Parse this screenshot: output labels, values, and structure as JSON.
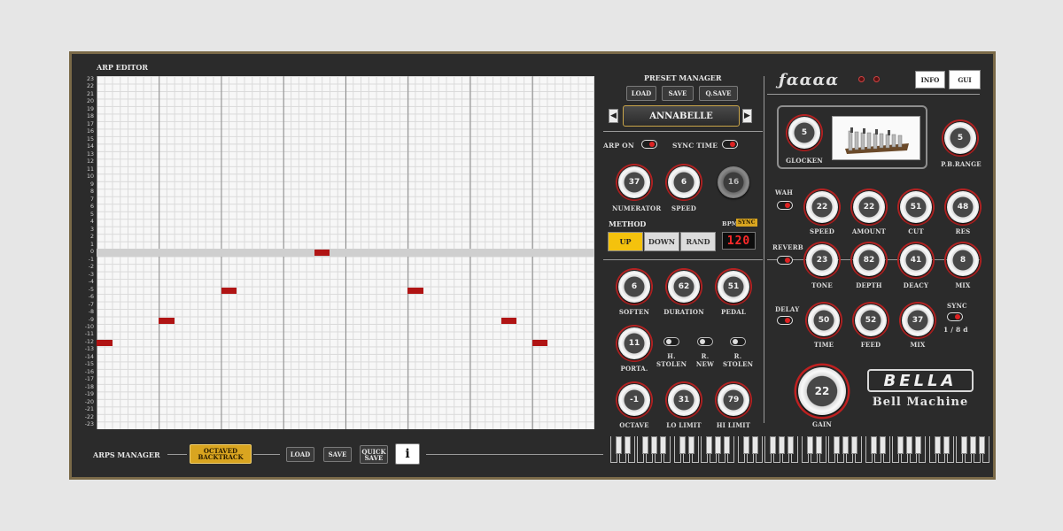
{
  "arp_editor": {
    "title": "ARP EDITOR",
    "row_labels": [
      "23",
      "22",
      "21",
      "20",
      "19",
      "18",
      "17",
      "16",
      "15",
      "14",
      "13",
      "12",
      "11",
      "10",
      "9",
      "8",
      "7",
      "6",
      "5",
      "4",
      "3",
      "2",
      "1",
      "0",
      "-1",
      "-2",
      "-3",
      "-4",
      "-5",
      "-6",
      "-7",
      "-8",
      "-9",
      "-10",
      "-11",
      "-12",
      "-13",
      "-14",
      "-15",
      "-16",
      "-17",
      "-18",
      "-19",
      "-20",
      "-21",
      "-22",
      "-23"
    ],
    "notes": [
      {
        "step": 0,
        "pitch": -12
      },
      {
        "step": 8,
        "pitch": -9
      },
      {
        "step": 16,
        "pitch": -5
      },
      {
        "step": 28,
        "pitch": 0
      },
      {
        "step": 40,
        "pitch": -5
      },
      {
        "step": 52,
        "pitch": -9
      },
      {
        "step": 56,
        "pitch": -12
      }
    ]
  },
  "preset_manager": {
    "title": "PRESET MANAGER",
    "load": "LOAD",
    "save": "SAVE",
    "qsave": "Q.SAVE",
    "preset_name": "ANNABELLE",
    "prev": "◀",
    "next": "▶"
  },
  "arp": {
    "arp_on": "ARP ON",
    "sync_time": "SYNC TIME",
    "numerator_value": "37",
    "numerator_label": "NUMERATOR",
    "speed_value": "6",
    "speed_label": "SPEED",
    "third_value": "16",
    "method_label": "METHOD",
    "bpm_label": "BPM",
    "sync_label": "SYNC",
    "methods": [
      "UP",
      "DOWN",
      "RAND"
    ],
    "lcd_value": "120"
  },
  "play": {
    "soften_value": "6",
    "soften_label": "SOFTEN",
    "duration_value": "62",
    "duration_label": "DURATION",
    "pedal_value": "51",
    "pedal_label": "PEDAL",
    "porta_value": "11",
    "porta_label": "PORTA.",
    "h_stolen": "H.\nSTOLEN",
    "r_new": "R.\nNEW",
    "r_stolen": "R.\nSTOLEN",
    "octave_value": "-1",
    "octave_label": "OCTAVE",
    "lo_value": "31",
    "lo_label": "LO LIMIT",
    "hi_value": "79",
    "hi_label": "HI LIMIT"
  },
  "header": {
    "logo_text": "ƒαααα",
    "info": "INFO",
    "gui": "GUI"
  },
  "instrument": {
    "glocken_value": "5",
    "glocken_label": "GLOCKEN",
    "pbrange_value": "5",
    "pbrange_label": "P.B.RANGE"
  },
  "wah": {
    "label": "WAH",
    "speed_value": "22",
    "speed_label": "SPEED",
    "amount_value": "22",
    "amount_label": "AMOUNT",
    "cut_value": "51",
    "cut_label": "CUT",
    "res_value": "48",
    "res_label": "RES"
  },
  "reverb": {
    "label": "REVERB",
    "tone_value": "23",
    "tone_label": "TONE",
    "depth_value": "82",
    "depth_label": "DEPTH",
    "decay_value": "41",
    "decay_label": "DEACY",
    "mix_value": "8",
    "mix_label": "MIX"
  },
  "delay": {
    "label": "DELAY",
    "time_value": "50",
    "time_label": "TIME",
    "feed_value": "52",
    "feed_label": "FEED",
    "mix_value": "37",
    "mix_label": "MIX",
    "sync_label": "SYNC",
    "sync_value": "1 / 8 d"
  },
  "gain": {
    "value": "22",
    "label": "GAIN"
  },
  "brand": {
    "name": "BELLA",
    "subtitle": "Bell Machine"
  },
  "arps_manager": {
    "label": "ARPS MANAGER",
    "preset": "OCTAVED\nBACKTRACK",
    "load": "LOAD",
    "save": "SAVE",
    "quick_save": "QUICK\nSAVE",
    "info": "i"
  },
  "colors": {
    "accent": "#d9a520",
    "note": "#b01414",
    "panel": "#2b2b2b",
    "border": "#7a6a48"
  }
}
